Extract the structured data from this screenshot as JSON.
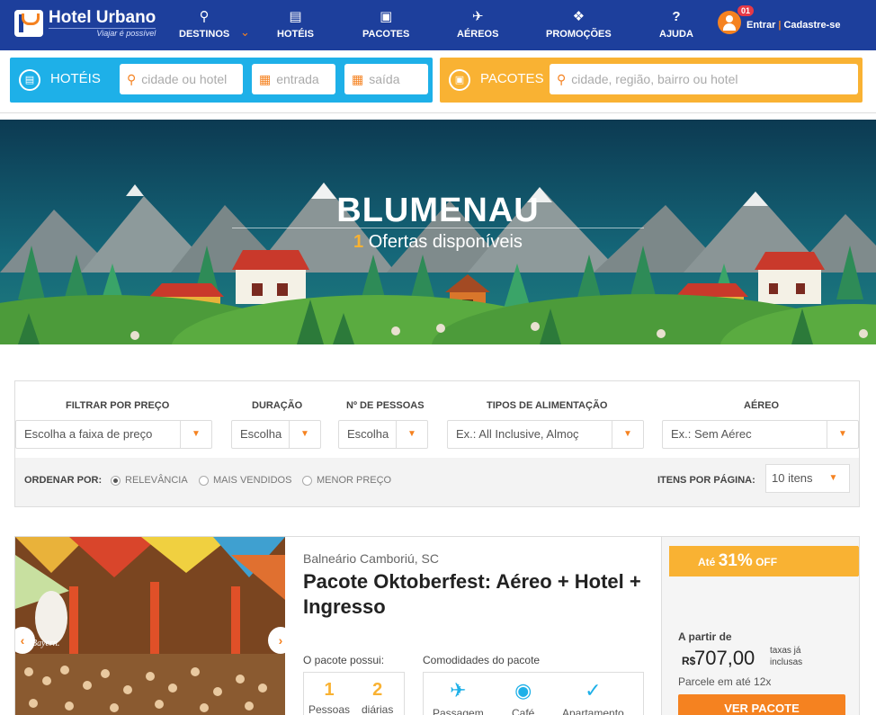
{
  "brand": {
    "name": "Hotel Urbano",
    "tagline": "Viajar é possível"
  },
  "nav": [
    {
      "label": "DESTINOS",
      "icon": "location-pin-icon"
    },
    {
      "label": "HOTÉIS",
      "icon": "bed-icon"
    },
    {
      "label": "PACOTES",
      "icon": "suitcase-icon"
    },
    {
      "label": "AÉREOS",
      "icon": "airplane-icon"
    },
    {
      "label": "PROMOÇÕES",
      "icon": "tag-icon"
    },
    {
      "label": "AJUDA",
      "icon": "question-icon"
    }
  ],
  "user": {
    "badge": "01",
    "login": "Entrar",
    "signup": "Cadastre-se"
  },
  "search": {
    "hotels_label": "HOTÉIS",
    "hotel_city_placeholder": "cidade ou hotel",
    "checkin_placeholder": "entrada",
    "checkout_placeholder": "saída",
    "packages_label": "PACOTES",
    "package_placeholder": "cidade, região, bairro ou hotel"
  },
  "hero": {
    "title": "BLUMENAU",
    "count": "1",
    "subtitle": "Ofertas disponíveis"
  },
  "filters": {
    "price": {
      "label": "FILTRAR POR PREÇO",
      "value": "Escolha a faixa de preço"
    },
    "duration": {
      "label": "DURAÇÃO",
      "value": "Escolha"
    },
    "people": {
      "label": "Nº DE PESSOAS",
      "value": "Escolha"
    },
    "meals": {
      "label": "TIPOS DE ALIMENTAÇÃO",
      "value": "Ex.: All Inclusive, Almoç"
    },
    "air": {
      "label": "AÉREO",
      "value": "Ex.: Sem Aérec"
    },
    "sort_label": "ORDENAR POR:",
    "sort_options": [
      "RELEVÂNCIA",
      "MAIS VENDIDOS",
      "MENOR PREÇO"
    ],
    "sort_selected": "RELEVÂNCIA",
    "per_page_label": "ITENS POR PÁGINA:",
    "per_page_value": "10 itens"
  },
  "result": {
    "location": "Balneário Camboriú, SC",
    "title": "Pacote Oktoberfest: Aéreo + Hotel + Ingresso",
    "photo_caption": "Bayern.",
    "includes_label": "O pacote possui:",
    "includes": [
      {
        "count": "1",
        "label": "Pessoas"
      },
      {
        "count": "2",
        "label": "diárias"
      }
    ],
    "amenities_label": "Comodidades do pacote",
    "amenities": [
      {
        "label": "Passagem",
        "icon": "airplane-icon"
      },
      {
        "label": "Café",
        "icon": "cloche-icon"
      },
      {
        "label": "Apartamento",
        "icon": "check-icon"
      }
    ],
    "discount_prefix": "Até",
    "discount_pct": "31%",
    "discount_suffix": "OFF",
    "from_label": "A partir de",
    "currency": "R$",
    "price": "707,00",
    "taxes_note": "taxas já inclusas",
    "installments": "Parcele em até 12x",
    "cta": "VER PACOTE"
  }
}
